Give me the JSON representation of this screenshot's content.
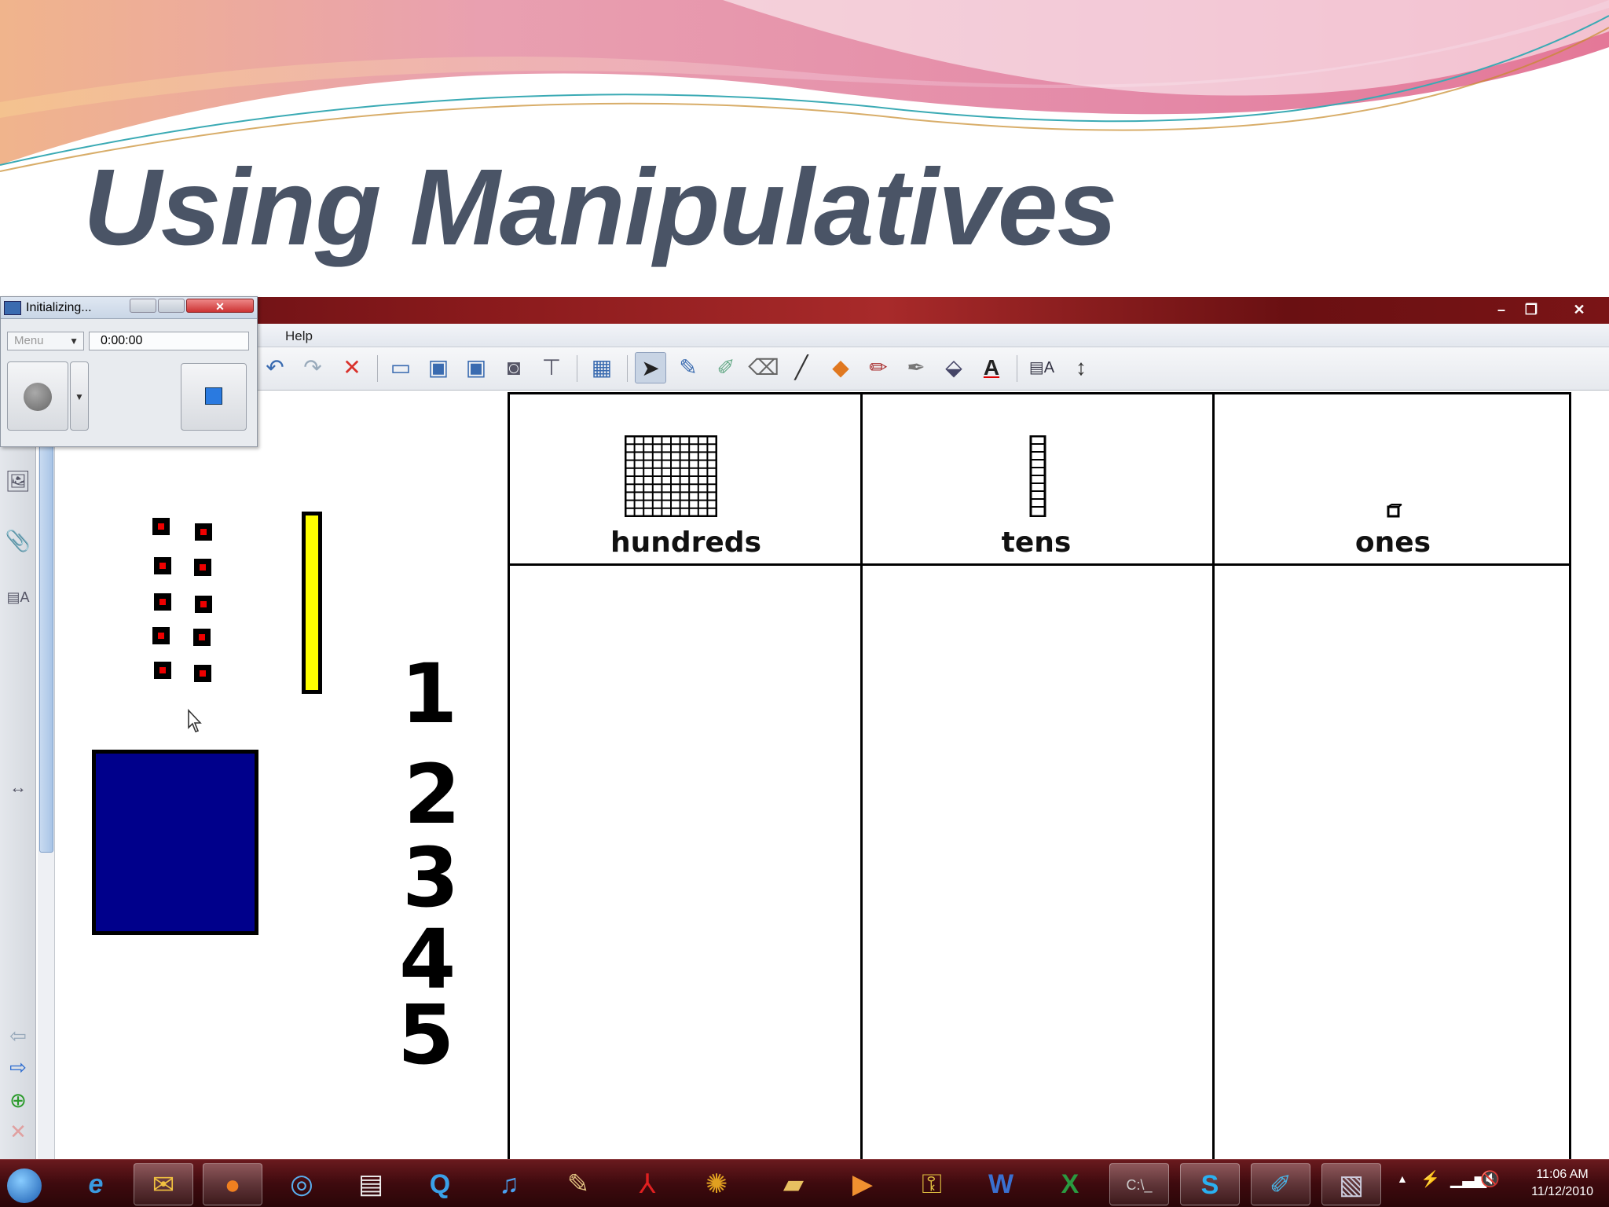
{
  "slide": {
    "title": "Using Manipulatives"
  },
  "app": {
    "menu": {
      "help": "Help"
    },
    "window_controls": {
      "minimize": "–",
      "restore": "❐",
      "close": "✕"
    },
    "toolbar_icons": [
      "undo-icon",
      "redo-icon",
      "delete-icon",
      "screen-shade-icon",
      "monitor-icon",
      "monitor-icon",
      "camera-icon",
      "document-camera-icon",
      "table-icon",
      "select-arrow-icon",
      "pen-icon",
      "creative-pen-icon",
      "eraser-icon",
      "line-icon",
      "shapes-icon",
      "magic-pen-icon",
      "highlighter-icon",
      "fill-icon",
      "text-icon",
      "properties-icon",
      "move-toolbar-icon"
    ]
  },
  "recorder": {
    "title": "Initializing...",
    "menu_label": "Menu",
    "time": "0:00:00"
  },
  "place_value": {
    "headers": [
      "hundreds",
      "tens",
      "ones"
    ]
  },
  "numbers": [
    "1",
    "2",
    "3",
    "4",
    "5"
  ],
  "taskbar": {
    "apps": [
      "start-orb-icon",
      "internet-explorer-icon",
      "outlook-icon",
      "firefox-icon",
      "safari-icon",
      "notepad-icon",
      "quicktime-icon",
      "itunes-icon",
      "paint-icon",
      "acrobat-icon",
      "picasa-icon",
      "explorer-folder-icon",
      "media-icon",
      "network-icon",
      "word-icon",
      "excel-icon",
      "cmd-icon",
      "skype-icon",
      "notebook-icon",
      "smart-recorder-icon"
    ],
    "clock_time": "11:06 AM",
    "clock_date": "11/12/2010"
  },
  "colors": {
    "title": "#4a5466",
    "ten_rod": "#ffff00",
    "hundred_flat": "#00008b",
    "unit_center": "#e00000"
  }
}
